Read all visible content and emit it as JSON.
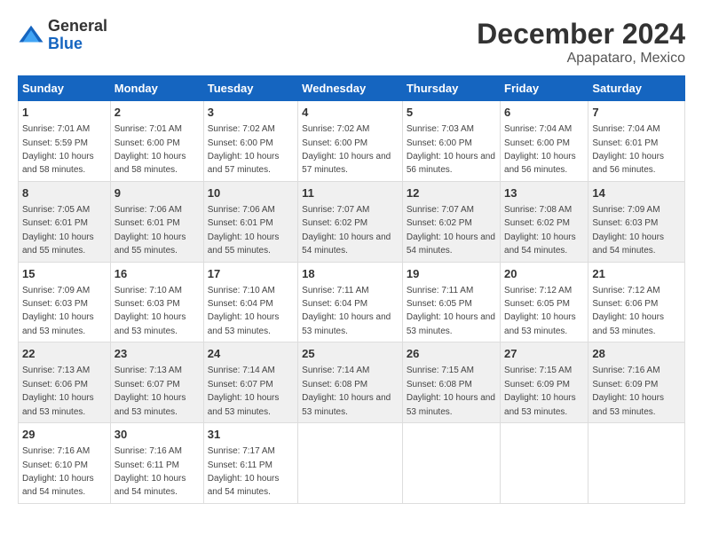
{
  "header": {
    "logo": {
      "general": "General",
      "blue": "Blue"
    },
    "title": "December 2024",
    "subtitle": "Apapataro, Mexico"
  },
  "calendar": {
    "days_of_week": [
      "Sunday",
      "Monday",
      "Tuesday",
      "Wednesday",
      "Thursday",
      "Friday",
      "Saturday"
    ],
    "weeks": [
      [
        null,
        null,
        null,
        null,
        null,
        null,
        {
          "day": "1",
          "sunrise": "7:01 AM",
          "sunset": "5:59 PM",
          "daylight": "10 hours and 58 minutes."
        }
      ],
      [
        {
          "day": "2",
          "sunrise": "7:01 AM",
          "sunset": "6:00 PM",
          "daylight": "10 hours and 58 minutes."
        },
        {
          "day": "3",
          "sunrise": "7:02 AM",
          "sunset": "6:00 PM",
          "daylight": "10 hours and 57 minutes."
        },
        {
          "day": "4",
          "sunrise": "7:02 AM",
          "sunset": "6:00 PM",
          "daylight": "10 hours and 57 minutes."
        },
        {
          "day": "5",
          "sunrise": "7:03 AM",
          "sunset": "6:00 PM",
          "daylight": "10 hours and 56 minutes."
        },
        {
          "day": "6",
          "sunrise": "7:04 AM",
          "sunset": "6:00 PM",
          "daylight": "10 hours and 56 minutes."
        },
        {
          "day": "7",
          "sunrise": "7:04 AM",
          "sunset": "6:01 PM",
          "daylight": "10 hours and 56 minutes."
        }
      ],
      [
        {
          "day": "8",
          "sunrise": "7:05 AM",
          "sunset": "6:01 PM",
          "daylight": "10 hours and 55 minutes."
        },
        {
          "day": "9",
          "sunrise": "7:06 AM",
          "sunset": "6:01 PM",
          "daylight": "10 hours and 55 minutes."
        },
        {
          "day": "10",
          "sunrise": "7:06 AM",
          "sunset": "6:01 PM",
          "daylight": "10 hours and 55 minutes."
        },
        {
          "day": "11",
          "sunrise": "7:07 AM",
          "sunset": "6:02 PM",
          "daylight": "10 hours and 54 minutes."
        },
        {
          "day": "12",
          "sunrise": "7:07 AM",
          "sunset": "6:02 PM",
          "daylight": "10 hours and 54 minutes."
        },
        {
          "day": "13",
          "sunrise": "7:08 AM",
          "sunset": "6:02 PM",
          "daylight": "10 hours and 54 minutes."
        },
        {
          "day": "14",
          "sunrise": "7:09 AM",
          "sunset": "6:03 PM",
          "daylight": "10 hours and 54 minutes."
        }
      ],
      [
        {
          "day": "15",
          "sunrise": "7:09 AM",
          "sunset": "6:03 PM",
          "daylight": "10 hours and 53 minutes."
        },
        {
          "day": "16",
          "sunrise": "7:10 AM",
          "sunset": "6:03 PM",
          "daylight": "10 hours and 53 minutes."
        },
        {
          "day": "17",
          "sunrise": "7:10 AM",
          "sunset": "6:04 PM",
          "daylight": "10 hours and 53 minutes."
        },
        {
          "day": "18",
          "sunrise": "7:11 AM",
          "sunset": "6:04 PM",
          "daylight": "10 hours and 53 minutes."
        },
        {
          "day": "19",
          "sunrise": "7:11 AM",
          "sunset": "6:05 PM",
          "daylight": "10 hours and 53 minutes."
        },
        {
          "day": "20",
          "sunrise": "7:12 AM",
          "sunset": "6:05 PM",
          "daylight": "10 hours and 53 minutes."
        },
        {
          "day": "21",
          "sunrise": "7:12 AM",
          "sunset": "6:06 PM",
          "daylight": "10 hours and 53 minutes."
        }
      ],
      [
        {
          "day": "22",
          "sunrise": "7:13 AM",
          "sunset": "6:06 PM",
          "daylight": "10 hours and 53 minutes."
        },
        {
          "day": "23",
          "sunrise": "7:13 AM",
          "sunset": "6:07 PM",
          "daylight": "10 hours and 53 minutes."
        },
        {
          "day": "24",
          "sunrise": "7:14 AM",
          "sunset": "6:07 PM",
          "daylight": "10 hours and 53 minutes."
        },
        {
          "day": "25",
          "sunrise": "7:14 AM",
          "sunset": "6:08 PM",
          "daylight": "10 hours and 53 minutes."
        },
        {
          "day": "26",
          "sunrise": "7:15 AM",
          "sunset": "6:08 PM",
          "daylight": "10 hours and 53 minutes."
        },
        {
          "day": "27",
          "sunrise": "7:15 AM",
          "sunset": "6:09 PM",
          "daylight": "10 hours and 53 minutes."
        },
        {
          "day": "28",
          "sunrise": "7:16 AM",
          "sunset": "6:09 PM",
          "daylight": "10 hours and 53 minutes."
        }
      ],
      [
        {
          "day": "29",
          "sunrise": "7:16 AM",
          "sunset": "6:10 PM",
          "daylight": "10 hours and 54 minutes."
        },
        {
          "day": "30",
          "sunrise": "7:16 AM",
          "sunset": "6:11 PM",
          "daylight": "10 hours and 54 minutes."
        },
        {
          "day": "31",
          "sunrise": "7:17 AM",
          "sunset": "6:11 PM",
          "daylight": "10 hours and 54 minutes."
        },
        null,
        null,
        null,
        null
      ]
    ]
  },
  "labels": {
    "sunrise": "Sunrise:",
    "sunset": "Sunset:",
    "daylight": "Daylight:"
  }
}
